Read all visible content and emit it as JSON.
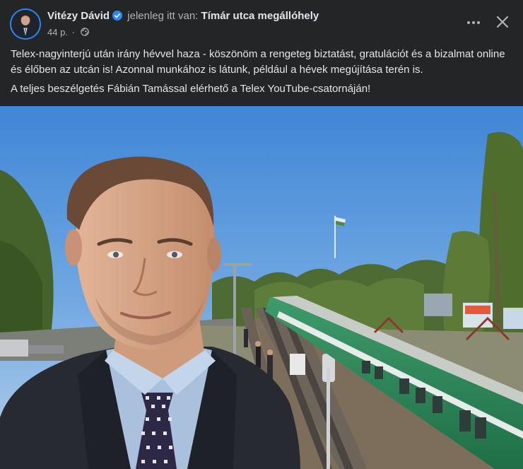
{
  "post": {
    "author_name": "Vitézy Dávid",
    "location_prefix": "jelenleg itt van:",
    "location_name": "Tímár utca megállóhely",
    "timestamp": "44 p.",
    "separator": "·",
    "paragraphs": [
      "Telex-nagyinterjú után irány hévvel haza - köszönöm a rengeteg biztatást, gratulációt és a bizalmat online és élőben az utcán is! Azonnal munkához is látunk, például a hévek megújítása terén is.",
      "A teljes beszélgetés Fábián Tamással elérhető a Telex YouTube-csatornáján!"
    ]
  },
  "icons": {
    "verified": "verified-badge-icon",
    "audience": "globe-icon",
    "more": "more-options-icon",
    "close": "close-icon"
  },
  "colors": {
    "background": "#242526",
    "text_primary": "#e4e6eb",
    "text_secondary": "#b0b3b8",
    "verified_blue": "#2d88ff",
    "hev_train_green": "#2e8b57"
  }
}
